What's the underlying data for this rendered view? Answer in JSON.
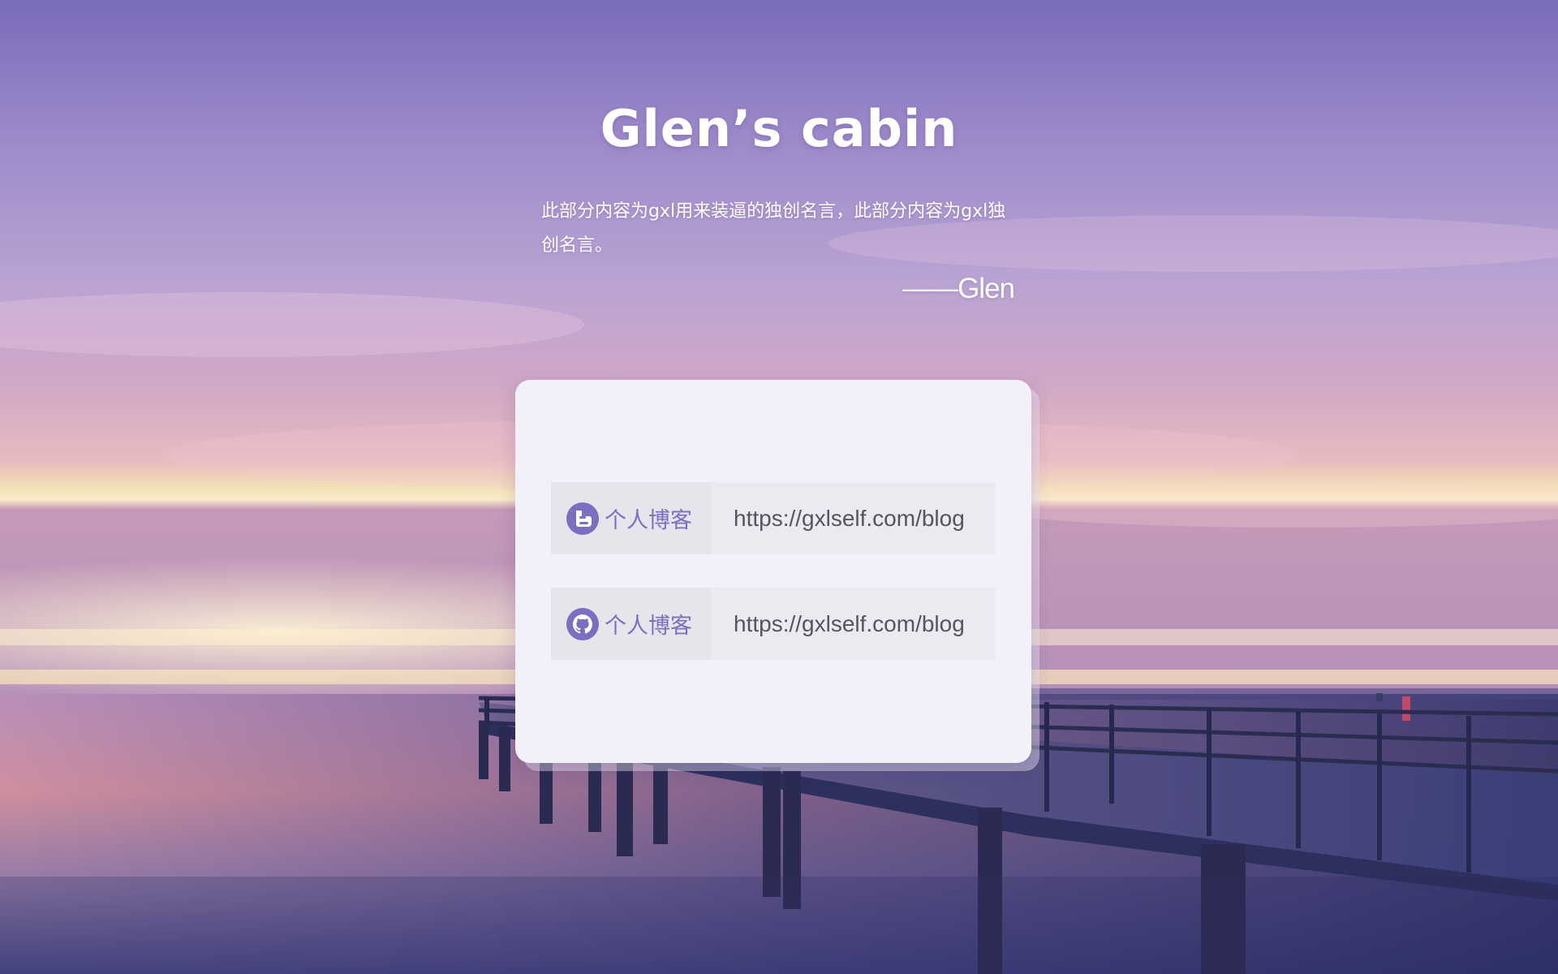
{
  "page": {
    "title": "Glen’s cabin",
    "quote": "此部分内容为gxl用来装逼的独创名言，此部分内容为gxl独创名言。",
    "author": "——Glen"
  },
  "links": [
    {
      "icon": "blogger-icon",
      "label": "个人博客",
      "url": "https://gxlself.com/blog"
    },
    {
      "icon": "github-icon",
      "label": "个人博客",
      "url": "https://gxlself.com/blog"
    }
  ],
  "colors": {
    "accent": "#7c6ec0",
    "card": "#f2f1f9",
    "row": "#ebeaf0",
    "url_text": "#555560",
    "sky_top": "#7d6dbd",
    "sea": "#4e4c8a"
  }
}
